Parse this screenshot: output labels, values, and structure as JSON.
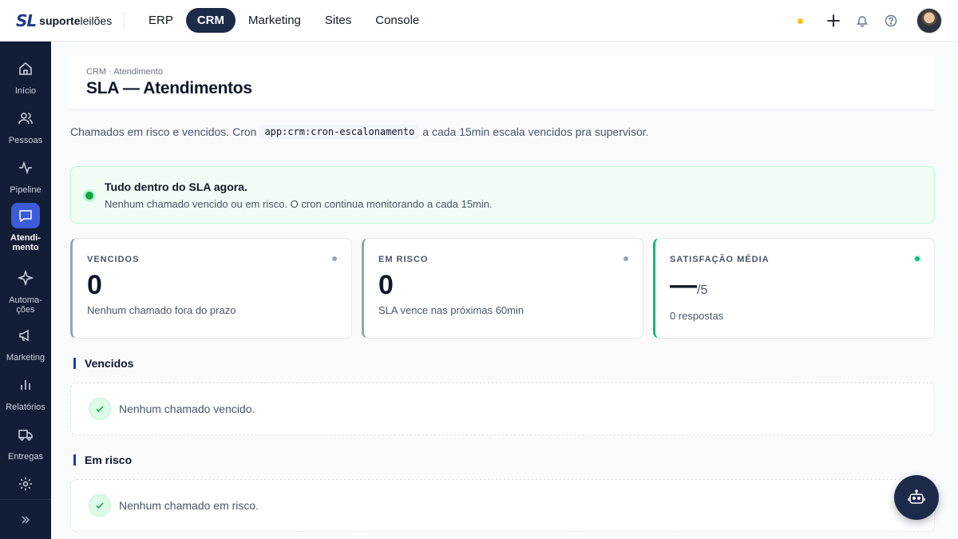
{
  "brand": {
    "mark": "SL",
    "name_bold": "suporte",
    "name_light": "leilões"
  },
  "topnav": [
    {
      "label": "ERP",
      "active": false
    },
    {
      "label": "CRM",
      "active": true
    },
    {
      "label": "Marketing",
      "active": false
    },
    {
      "label": "Sites",
      "active": false
    },
    {
      "label": "Console",
      "active": false
    }
  ],
  "topbar_icons": [
    "status-dot",
    "plus-icon",
    "bell-icon",
    "help-icon",
    "avatar"
  ],
  "sidebar": [
    {
      "label": "Início",
      "icon": "home-icon"
    },
    {
      "label": "Pessoas",
      "icon": "people-icon"
    },
    {
      "label": "Pipeline",
      "icon": "pulse-icon"
    },
    {
      "label": "Atendi-\nmento",
      "icon": "chat-icon",
      "active": true
    },
    {
      "label": "Automa-\nções",
      "icon": "sparkle-icon"
    },
    {
      "label": "Marketing",
      "icon": "megaphone-icon"
    },
    {
      "label": "Relatórios",
      "icon": "bar-chart-icon"
    },
    {
      "label": "Entregas",
      "icon": "truck-icon"
    },
    {
      "label": "",
      "icon": "gear-icon"
    }
  ],
  "page": {
    "breadcrumb": "CRM · Atendimento",
    "title": "SLA — Atendimentos",
    "desc_before": "Chamados em risco e vencidos. Cron",
    "desc_code": "app:crm:cron-escalonamento",
    "desc_after": "a cada 15min escala vencidos pra supervisor."
  },
  "banner": {
    "title": "Tudo dentro do SLA agora.",
    "subtitle": "Nenhum chamado vencido ou em risco. O cron continua monitorando a cada 15min."
  },
  "cards": [
    {
      "label": "VENCIDOS",
      "value": "0",
      "suffix": "",
      "sub": "Nenhum chamado fora do prazo"
    },
    {
      "label": "EM RISCO",
      "value": "0",
      "suffix": "",
      "sub": "SLA vence nas próximas 60min"
    },
    {
      "label": "SATISFAÇÃO MÉDIA",
      "value": "—",
      "suffix": "/5",
      "sub": "0 respostas"
    }
  ],
  "sections": {
    "overdue": {
      "title": "Vencidos",
      "empty": "Nenhum chamado vencido."
    },
    "at_risk": {
      "title": "Em risco",
      "empty": "Nenhum chamado em risco."
    }
  },
  "colors": {
    "accent": "#1e2a4a",
    "sidebar": "#121d36",
    "active_side": "#3b5bd9",
    "ok": "#16a34a",
    "warn_dot": "#fbbf24"
  }
}
